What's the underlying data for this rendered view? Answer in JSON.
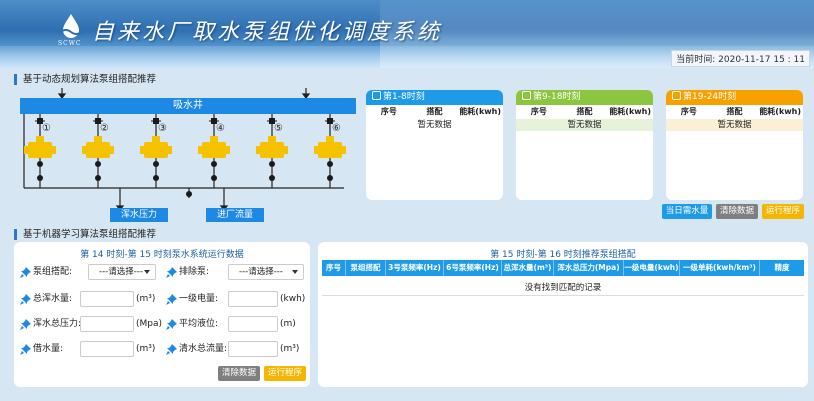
{
  "header": {
    "logo_text": "SCWC",
    "title": "自来水厂取水泵组优化调度系统",
    "datetime": "当前时间: 2020-11-17 15 : 11"
  },
  "section1": {
    "title": "基于动态规划算法泵组搭配推荐",
    "shaft_label": "吸水井",
    "pumps": [
      "①",
      "②",
      "③",
      "④",
      "⑤",
      "⑥"
    ],
    "tag_pressure": "浑水压力",
    "tag_flow": "进厂流量"
  },
  "cards": [
    {
      "title": "第1-8时刻",
      "color": "#1e9be8",
      "cols": [
        "序号",
        "搭配",
        "能耗(kwh)"
      ],
      "empty": "暂无数据",
      "empty_bg": "#ffffff"
    },
    {
      "title": "第9-18时刻",
      "color": "#8cc63f",
      "cols": [
        "序号",
        "搭配",
        "能耗(kwh)"
      ],
      "empty": "暂无数据",
      "empty_bg": "#e6f3d8"
    },
    {
      "title": "第19-24时刻",
      "color": "#f6a100",
      "cols": [
        "序号",
        "搭配",
        "能耗(kwh)"
      ],
      "empty": "暂无数据",
      "empty_bg": "#fbefd5"
    }
  ],
  "buttons1": {
    "daily_demand": "当日需水量",
    "clear": "清除数据",
    "run": "运行程序"
  },
  "section2": {
    "title": "基于机器学习算法泵组搭配推荐",
    "left_title": "第 14 时刻-第 15 时刻泵水系统运行数据",
    "fields": {
      "pump_combo": "泵组搭配:",
      "pump_combo_value": "---请选择---",
      "drain_pump": "排除泵:",
      "drain_pump_value": "---请选择---",
      "total_raw": "总浑水量:",
      "total_raw_unit": "(m³)",
      "power1": "一级电量:",
      "power1_unit": "(kwh)",
      "raw_pressure": "浑水总压力:",
      "raw_pressure_unit": "(Mpa)",
      "level": "平均液位:",
      "level_unit": "(m)",
      "borrow": "借水量:",
      "borrow_unit": "(m³)",
      "clear_total": "清水总流量:",
      "clear_total_unit": "(m³)"
    },
    "buttons": {
      "clear": "清除数据",
      "run": "运行程序"
    },
    "right_title": "第 15 时刻-第 16 时刻推荐泵组搭配",
    "table_cols": [
      "序号",
      "泵组搭配",
      "3号泵频率(Hz)",
      "6号泵频率(Hz)",
      "总浑水量(m³)",
      "浑水总压力(Mpa)",
      "一级电量(kwh)",
      "一级单耗(kwh/km³)",
      "精度"
    ],
    "no_record": "没有找到匹配的记录"
  },
  "colors": {
    "accent": "#1e9be8",
    "pump": "#f5c200",
    "dark": "#1a1a1a"
  }
}
